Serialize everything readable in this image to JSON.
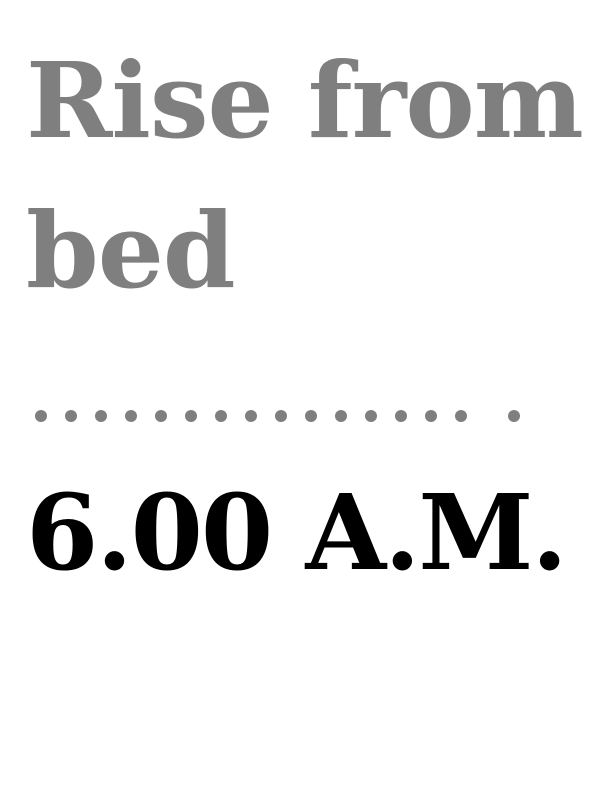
{
  "schedule_entry": {
    "activity": "Rise from bed",
    "time": "6.00 A.M.",
    "colors": {
      "activity_text": "#7f7f7f",
      "leader_dots": "#7f7f7f",
      "time_text": "#000000",
      "background": "#ffffff"
    }
  }
}
